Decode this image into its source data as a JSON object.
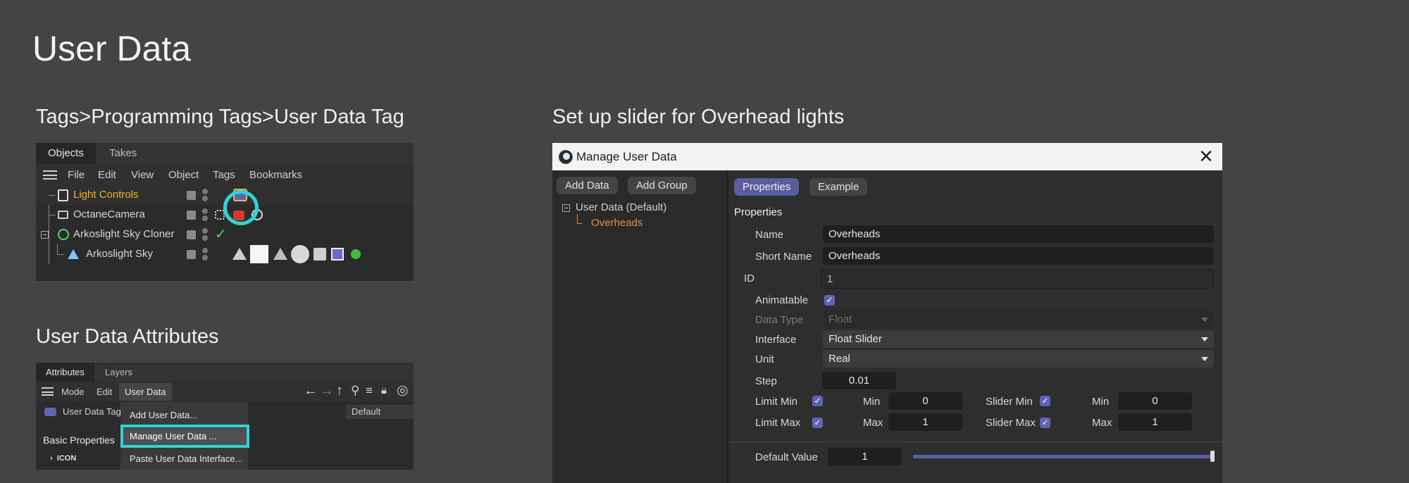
{
  "slide": {
    "title": "User Data"
  },
  "section1": {
    "title": "Tags>Programming Tags>User Data Tag"
  },
  "section2": {
    "title": "User Data Attributes"
  },
  "section3": {
    "title": "Set up slider for Overhead lights"
  },
  "objects_panel": {
    "tabs": [
      "Objects",
      "Takes"
    ],
    "menu": [
      "File",
      "Edit",
      "View",
      "Object",
      "Tags",
      "Bookmarks"
    ],
    "rows": [
      {
        "label": "Light Controls",
        "color": "#f0b431"
      },
      {
        "label": "OctaneCamera",
        "color": "#d6d6d6"
      },
      {
        "label": "Arkoslight Sky Cloner",
        "color": "#d6d6d6"
      },
      {
        "label": "Arkoslight Sky",
        "color": "#d6d6d6"
      }
    ]
  },
  "attributes_panel": {
    "tabs": [
      "Attributes",
      "Layers"
    ],
    "menu": [
      "Mode",
      "Edit",
      "User Data"
    ],
    "object_label": "User Data Tag",
    "default_label": "Default",
    "basic_properties": "Basic Properties",
    "icon_label": "ICON",
    "dropdown": [
      "Add User Data...",
      "Manage User Data ...",
      "Paste User Data Interface..."
    ]
  },
  "dialog": {
    "title": "Manage User Data",
    "buttons": {
      "add_data": "Add Data",
      "add_group": "Add Group"
    },
    "tabs": {
      "properties": "Properties",
      "example": "Example"
    },
    "tree": {
      "root": "User Data (Default)",
      "child": "Overheads"
    },
    "section_heading": "Properties",
    "labels": {
      "name": "Name",
      "short_name": "Short Name",
      "id": "ID",
      "animatable": "Animatable",
      "data_type": "Data Type",
      "interface": "Interface",
      "unit": "Unit",
      "step": "Step",
      "limit_min": "Limit Min",
      "limit_max": "Limit Max",
      "min": "Min",
      "max": "Max",
      "slider_min": "Slider Min",
      "slider_max": "Slider Max",
      "default_value": "Default Value"
    },
    "values": {
      "name": "Overheads",
      "short_name": "Overheads",
      "id": "1",
      "data_type": "Float",
      "interface": "Float Slider",
      "unit": "Real",
      "step": "0.01",
      "limit_min": "0",
      "limit_max": "1",
      "slider_min": "0",
      "slider_max": "1",
      "default_value": "1",
      "default_fraction": 1.0
    },
    "accent": "#5d63b5",
    "tree_child_color": "#f08a3c"
  },
  "highlight_color": "#2fd3d8"
}
